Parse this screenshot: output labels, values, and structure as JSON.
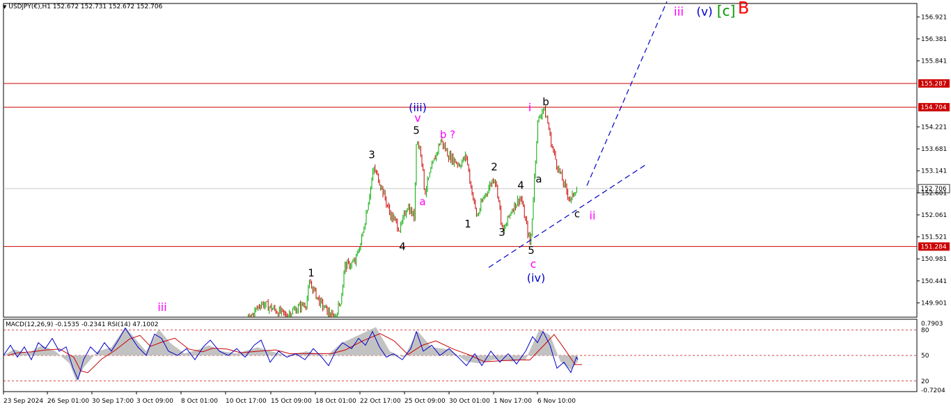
{
  "header": {
    "symbol_line": "USDJPY(€),H1  152.672 152.731 152.672 152.706",
    "indicator_line": "MACD(12,26,9) -0.1535 -0.2341  RSI(14) 47.1002"
  },
  "colors": {
    "candle_up": "#00aa00",
    "candle_down": "#cc0000",
    "level_line": "#cc0000",
    "trend_line": "#0000cc",
    "wave_magenta": "#ff00ff",
    "wave_blue": "#0000cc",
    "wave_green": "#009900",
    "wave_red": "#ff0000",
    "macd_fill": "#bbbbbb",
    "macd_signal": "#cc0000",
    "rsi_line": "#0000cc"
  },
  "chart_data": {
    "type": "candlestick",
    "symbol": "USDJPY(€)",
    "timeframe": "H1",
    "ohlc": {
      "open": 152.672,
      "high": 152.731,
      "low": 152.672,
      "close": 152.706
    },
    "current_price": 152.706,
    "ylim": [
      149.55,
      157.25
    ],
    "y_ticks": [
      "156.921",
      "156.381",
      "155.841",
      "154.221",
      "153.681",
      "153.141",
      "152.601",
      "152.061",
      "151.521",
      "150.981",
      "150.441",
      "149.901"
    ],
    "x_ticks": [
      "23 Sep 2024",
      "26 Sep 01:00",
      "30 Sep 17:00",
      "3 Oct 09:00",
      "8 Oct 01:00",
      "10 Oct 17:00",
      "15 Oct 09:00",
      "18 Oct 01:00",
      "22 Oct 17:00",
      "25 Oct 09:00",
      "30 Oct 01:00",
      "1 Nov 17:00",
      "6 Nov 10:00"
    ],
    "horizontal_levels": [
      {
        "value": 155.287,
        "label": "155.287"
      },
      {
        "value": 154.704,
        "label": "154.704"
      },
      {
        "value": 151.284,
        "label": "151.284"
      }
    ],
    "price_path": [
      [
        0,
        149.4
      ],
      [
        55,
        149.0
      ],
      [
        90,
        148.6
      ],
      [
        120,
        148.9
      ],
      [
        160,
        148.4
      ],
      [
        200,
        148.6
      ],
      [
        240,
        148.9
      ],
      [
        300,
        148.7
      ],
      [
        340,
        149.1
      ],
      [
        375,
        149.9
      ],
      [
        410,
        149.6
      ],
      [
        440,
        149.9
      ],
      [
        445,
        150.4
      ],
      [
        460,
        149.9
      ],
      [
        480,
        149.5
      ],
      [
        490,
        150.0
      ],
      [
        495,
        150.8
      ],
      [
        510,
        150.9
      ],
      [
        520,
        151.5
      ],
      [
        530,
        152.5
      ],
      [
        537,
        153.2
      ],
      [
        545,
        152.9
      ],
      [
        560,
        152.1
      ],
      [
        575,
        151.7
      ],
      [
        585,
        152.3
      ],
      [
        595,
        152.0
      ],
      [
        598,
        153.9
      ],
      [
        605,
        153.6
      ],
      [
        610,
        152.6
      ],
      [
        620,
        153.2
      ],
      [
        633,
        153.9
      ],
      [
        645,
        153.5
      ],
      [
        660,
        153.3
      ],
      [
        670,
        153.5
      ],
      [
        675,
        152.9
      ],
      [
        685,
        152.0
      ],
      [
        695,
        152.5
      ],
      [
        710,
        153.0
      ],
      [
        715,
        152.6
      ],
      [
        722,
        151.6
      ],
      [
        735,
        152.2
      ],
      [
        748,
        152.5
      ],
      [
        755,
        151.9
      ],
      [
        762,
        151.3
      ],
      [
        767,
        152.8
      ],
      [
        772,
        154.3
      ],
      [
        780,
        154.7
      ],
      [
        786,
        154.4
      ],
      [
        792,
        153.8
      ],
      [
        800,
        153.3
      ],
      [
        810,
        152.8
      ],
      [
        820,
        152.4
      ],
      [
        826,
        152.7
      ],
      [
        830,
        152.706
      ]
    ],
    "x_range": [
      0,
      1310
    ],
    "trendlines": [
      {
        "from": [
          702,
          150.77
        ],
        "to": [
          930,
          153.32
        ],
        "style": "dashed"
      },
      {
        "from": [
          843,
          152.78
        ],
        "to": [
          958,
          157.3
        ],
        "style": "dashed"
      }
    ],
    "wave_labels": [
      {
        "text": "iii",
        "x": 975,
        "y": 156.95,
        "color": "wave_magenta",
        "size": 17
      },
      {
        "text": "(v)",
        "x": 1012,
        "y": 156.95,
        "color": "wave_blue",
        "size": 17
      },
      {
        "text": "[c]",
        "x": 1043,
        "y": 156.95,
        "color": "wave_green",
        "size": 20
      },
      {
        "text": "B",
        "x": 1068,
        "y": 157.0,
        "color": "wave_red",
        "size": 24
      },
      {
        "text": "(iii)",
        "x": 600,
        "y": 154.6,
        "color": "wave_blue",
        "size": 16
      },
      {
        "text": "v",
        "x": 600,
        "y": 154.35,
        "color": "wave_magenta",
        "size": 16
      },
      {
        "text": "5",
        "x": 598,
        "y": 154.05,
        "color": "#000000",
        "size": 15
      },
      {
        "text": "b ?",
        "x": 643,
        "y": 153.95,
        "color": "wave_magenta",
        "size": 15
      },
      {
        "text": "3",
        "x": 534,
        "y": 153.45,
        "color": "#000000",
        "size": 15
      },
      {
        "text": "a",
        "x": 607,
        "y": 152.3,
        "color": "wave_magenta",
        "size": 15
      },
      {
        "text": "4",
        "x": 578,
        "y": 151.2,
        "color": "#000000",
        "size": 15
      },
      {
        "text": "1",
        "x": 672,
        "y": 151.75,
        "color": "#000000",
        "size": 15
      },
      {
        "text": "2",
        "x": 710,
        "y": 153.15,
        "color": "#000000",
        "size": 15
      },
      {
        "text": "3",
        "x": 721,
        "y": 151.55,
        "color": "#000000",
        "size": 15
      },
      {
        "text": "4",
        "x": 748,
        "y": 152.7,
        "color": "#000000",
        "size": 15
      },
      {
        "text": "5",
        "x": 763,
        "y": 151.1,
        "color": "#000000",
        "size": 15
      },
      {
        "text": "c",
        "x": 766,
        "y": 150.76,
        "color": "wave_magenta",
        "size": 16
      },
      {
        "text": "(iv)",
        "x": 770,
        "y": 150.42,
        "color": "wave_blue",
        "size": 16
      },
      {
        "text": "a",
        "x": 774,
        "y": 152.85,
        "color": "#000000",
        "size": 15
      },
      {
        "text": "i",
        "x": 761,
        "y": 154.6,
        "color": "wave_magenta",
        "size": 16
      },
      {
        "text": "b",
        "x": 784,
        "y": 154.75,
        "color": "#000000",
        "size": 15
      },
      {
        "text": "c",
        "x": 829,
        "y": 152.0,
        "color": "#000000",
        "size": 15
      },
      {
        "text": "ii",
        "x": 851,
        "y": 151.95,
        "color": "wave_magenta",
        "size": 16
      },
      {
        "text": "1",
        "x": 447,
        "y": 150.55,
        "color": "#000000",
        "size": 15
      },
      {
        "text": "iii",
        "x": 233,
        "y": 149.7,
        "color": "wave_magenta",
        "size": 16
      }
    ],
    "indicator": {
      "type": "MACD + RSI",
      "macd_params": "12,26,9",
      "macd_value": -0.1535,
      "signal_value": -0.2341,
      "rsi_period": 14,
      "rsi_value": 47.1002,
      "right_scale": [
        "0.7903",
        "80",
        "50",
        "20",
        "-0.7204"
      ],
      "rsi_levels": [
        80,
        50,
        20
      ],
      "macd_path": [
        [
          5,
          0.0
        ],
        [
          20,
          0.15
        ],
        [
          40,
          0.05
        ],
        [
          60,
          0.25
        ],
        [
          80,
          0.1
        ],
        [
          100,
          -0.2
        ],
        [
          110,
          -0.65
        ],
        [
          120,
          -0.3
        ],
        [
          140,
          0.1
        ],
        [
          160,
          0.2
        ],
        [
          180,
          0.7
        ],
        [
          195,
          0.4
        ],
        [
          210,
          0.1
        ],
        [
          228,
          0.65
        ],
        [
          245,
          0.3
        ],
        [
          265,
          0.05
        ],
        [
          285,
          0.15
        ],
        [
          300,
          0.25
        ],
        [
          320,
          0.1
        ],
        [
          340,
          0.05
        ],
        [
          370,
          0.2
        ],
        [
          390,
          0.1
        ],
        [
          410,
          0.0
        ],
        [
          440,
          0.1
        ],
        [
          470,
          0.0
        ],
        [
          490,
          0.3
        ],
        [
          515,
          0.5
        ],
        [
          540,
          0.7
        ],
        [
          560,
          0.1
        ],
        [
          580,
          -0.05
        ],
        [
          600,
          0.6
        ],
        [
          620,
          0.2
        ],
        [
          645,
          0.15
        ],
        [
          670,
          -0.15
        ],
        [
          690,
          -0.2
        ],
        [
          710,
          -0.1
        ],
        [
          735,
          -0.15
        ],
        [
          755,
          -0.1
        ],
        [
          775,
          0.65
        ],
        [
          790,
          0.5
        ],
        [
          805,
          -0.15
        ],
        [
          820,
          -0.35
        ],
        [
          830,
          -0.15
        ]
      ],
      "rsi_path": [
        [
          5,
          50
        ],
        [
          15,
          62
        ],
        [
          25,
          48
        ],
        [
          35,
          60
        ],
        [
          45,
          45
        ],
        [
          55,
          65
        ],
        [
          65,
          58
        ],
        [
          75,
          70
        ],
        [
          85,
          55
        ],
        [
          95,
          60
        ],
        [
          105,
          35
        ],
        [
          112,
          22
        ],
        [
          120,
          45
        ],
        [
          130,
          60
        ],
        [
          140,
          52
        ],
        [
          150,
          65
        ],
        [
          160,
          55
        ],
        [
          170,
          68
        ],
        [
          180,
          82
        ],
        [
          188,
          72
        ],
        [
          198,
          60
        ],
        [
          210,
          50
        ],
        [
          222,
          75
        ],
        [
          232,
          70
        ],
        [
          242,
          55
        ],
        [
          255,
          50
        ],
        [
          268,
          58
        ],
        [
          280,
          45
        ],
        [
          292,
          60
        ],
        [
          302,
          68
        ],
        [
          315,
          55
        ],
        [
          328,
          50
        ],
        [
          340,
          58
        ],
        [
          352,
          48
        ],
        [
          365,
          62
        ],
        [
          375,
          68
        ],
        [
          388,
          42
        ],
        [
          400,
          55
        ],
        [
          412,
          48
        ],
        [
          425,
          52
        ],
        [
          438,
          45
        ],
        [
          450,
          58
        ],
        [
          462,
          48
        ],
        [
          472,
          38
        ],
        [
          482,
          55
        ],
        [
          492,
          65
        ],
        [
          505,
          58
        ],
        [
          515,
          70
        ],
        [
          525,
          62
        ],
        [
          535,
          78
        ],
        [
          545,
          60
        ],
        [
          555,
          48
        ],
        [
          565,
          52
        ],
        [
          578,
          45
        ],
        [
          590,
          58
        ],
        [
          598,
          78
        ],
        [
          608,
          55
        ],
        [
          620,
          62
        ],
        [
          632,
          50
        ],
        [
          645,
          58
        ],
        [
          658,
          48
        ],
        [
          670,
          38
        ],
        [
          682,
          52
        ],
        [
          692,
          38
        ],
        [
          705,
          55
        ],
        [
          718,
          42
        ],
        [
          730,
          52
        ],
        [
          742,
          40
        ],
        [
          755,
          55
        ],
        [
          765,
          72
        ],
        [
          772,
          65
        ],
        [
          780,
          78
        ],
        [
          790,
          62
        ],
        [
          800,
          35
        ],
        [
          810,
          42
        ],
        [
          820,
          30
        ],
        [
          828,
          48
        ],
        [
          830,
          45
        ]
      ]
    }
  }
}
